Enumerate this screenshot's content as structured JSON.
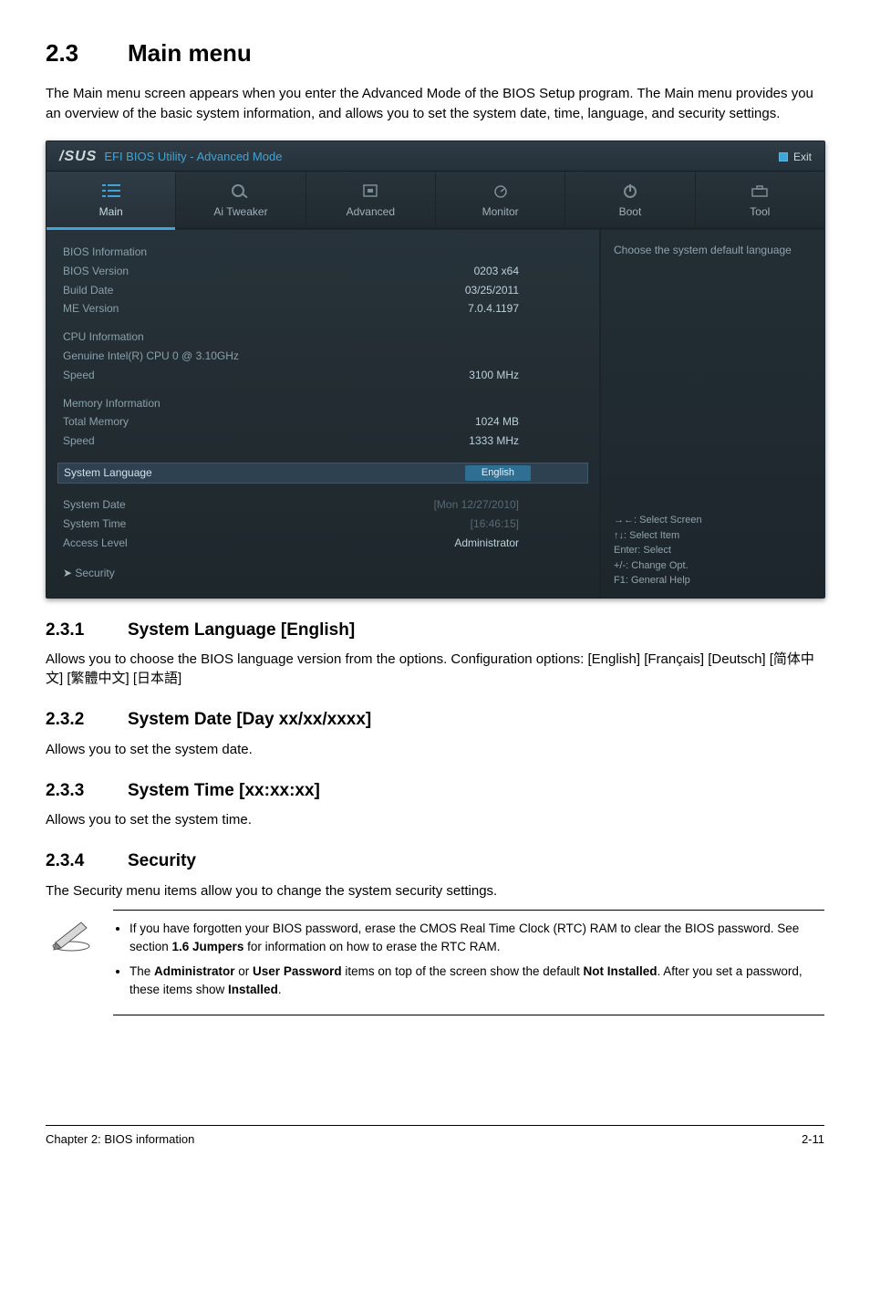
{
  "section": {
    "num": "2.3",
    "title": "Main menu"
  },
  "intro": "The Main menu screen appears when you enter the Advanced Mode of the BIOS Setup program. The Main menu provides you an overview of the basic system information, and allows you to set the system date, time, language, and security settings.",
  "bios": {
    "logo": "/SUS",
    "title": "EFI BIOS Utility - Advanced Mode",
    "exit": "Exit",
    "tabs": {
      "main": "Main",
      "tweaker": "Ai Tweaker",
      "advanced": "Advanced",
      "monitor": "Monitor",
      "boot": "Boot",
      "tool": "Tool"
    },
    "left": {
      "biosInfoHead": "BIOS Information",
      "biosVersionLabel": "BIOS Version",
      "biosVersionValue": "0203 x64",
      "buildDateLabel": "Build Date",
      "buildDateValue": "03/25/2011",
      "meVersionLabel": "ME Version",
      "meVersionValue": "7.0.4.1197",
      "cpuInfoHead": "CPU Information",
      "cpuName": "Genuine Intel(R) CPU 0 @ 3.10GHz",
      "cpuSpeedLabel": "Speed",
      "cpuSpeedValue": "3100 MHz",
      "memInfoHead": "Memory Information",
      "totalMemLabel": "Total Memory",
      "totalMemValue": "1024 MB",
      "memSpeedLabel": "Speed",
      "memSpeedValue": "1333 MHz",
      "sysLangLabel": "System Language",
      "sysLangValue": "English",
      "sysDateLabel": "System Date",
      "sysDateValue": "[Mon 12/27/2010]",
      "sysTimeLabel": "System Time",
      "sysTimeValue": "[16:46:15]",
      "accessLabel": "Access Level",
      "accessValue": "Administrator",
      "securityLabel": "Security"
    },
    "right": {
      "hint": "Choose the system default language",
      "help1": "→←:  Select Screen",
      "help2": "↑↓:  Select Item",
      "help3": "Enter:  Select",
      "help4": "+/-:  Change Opt.",
      "help5": "F1:  General Help"
    }
  },
  "subs": {
    "s231num": "2.3.1",
    "s231title": "System Language [English]",
    "s231body": "Allows you to choose the BIOS language version from the options. Configuration options: [English] [Français] [Deutsch] [简体中文] [繁體中文] [日本語]",
    "s232num": "2.3.2",
    "s232title": "System Date [Day xx/xx/xxxx]",
    "s232body": "Allows you to set the system date.",
    "s233num": "2.3.3",
    "s233title": "System Time [xx:xx:xx]",
    "s233body": "Allows you to set the system time.",
    "s234num": "2.3.4",
    "s234title": "Security",
    "s234body": "The Security menu items allow you to change the system security settings."
  },
  "notes": {
    "n1a": "If you have forgotten your BIOS password, erase the CMOS Real Time Clock (RTC) RAM to clear the BIOS password. See section ",
    "n1b": "1.6 Jumpers",
    "n1c": " for information on how to erase the RTC RAM.",
    "n2a": "The ",
    "n2b": "Administrator",
    "n2c": " or ",
    "n2d": "User Password",
    "n2e": " items on top of the screen show the default ",
    "n2f": "Not Installed",
    "n2g": ". After you set a password, these items show ",
    "n2h": "Installed",
    "n2i": "."
  },
  "footer": {
    "left": "Chapter 2: BIOS information",
    "right": "2-11"
  }
}
